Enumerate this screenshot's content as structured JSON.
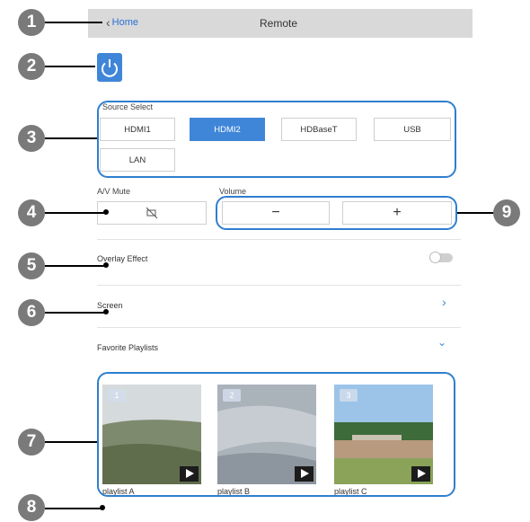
{
  "header": {
    "back_label": "Home",
    "title": "Remote"
  },
  "source_select": {
    "label": "Source Select",
    "options": [
      "HDMI1",
      "HDMI2",
      "HDBaseT",
      "USB",
      "LAN"
    ],
    "selected": "HDMI2"
  },
  "av_mute": {
    "label": "A/V Mute"
  },
  "volume": {
    "label": "Volume",
    "minus": "−",
    "plus": "+"
  },
  "overlay_effect": {
    "label": "Overlay Effect",
    "enabled": false
  },
  "screen": {
    "label": "Screen"
  },
  "favorites": {
    "label": "Favorite Playlists",
    "playlists": [
      {
        "number": "1",
        "name": "playlist A"
      },
      {
        "number": "2",
        "name": "playlist B"
      },
      {
        "number": "3",
        "name": "playlist C"
      }
    ]
  },
  "callouts": [
    "1",
    "2",
    "3",
    "4",
    "5",
    "6",
    "7",
    "8",
    "9"
  ],
  "colors": {
    "accent": "#3f86d9",
    "header_bg": "#d9d9d9",
    "callout": "#7a7a7a"
  }
}
